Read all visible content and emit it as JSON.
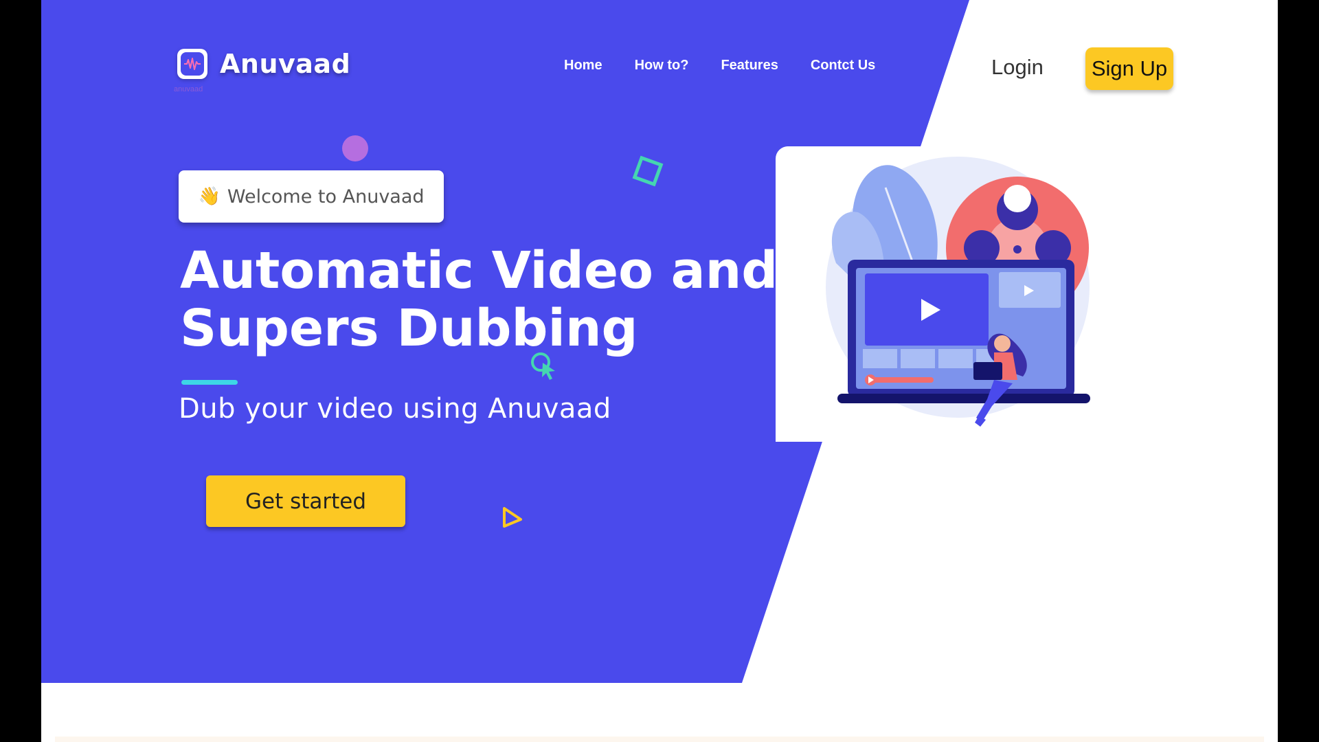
{
  "brand": {
    "name": "Anuvaad",
    "subtext": "anuvaad"
  },
  "nav": {
    "items": [
      {
        "label": "Home"
      },
      {
        "label": "How to?"
      },
      {
        "label": "Features"
      },
      {
        "label": "Contct Us"
      }
    ],
    "login_label": "Login",
    "signup_label": "Sign Up"
  },
  "hero": {
    "welcome_emoji": "👋",
    "welcome_text": "Welcome to Anuvaad",
    "headline_line1": "Automatic Video and",
    "headline_line2": "Supers Dubbing",
    "subheadline": "Dub your video using Anuvaad",
    "cta_label": "Get started"
  },
  "icons": {
    "logo": "audio-wave-icon",
    "hand": "waving-hand-icon",
    "illustration": "video-dubbing-illustration"
  },
  "colors": {
    "primary": "#4a4aec",
    "accent_yellow": "#fcc823",
    "accent_cyan": "#3dd6e6",
    "text_dark": "#333333"
  }
}
